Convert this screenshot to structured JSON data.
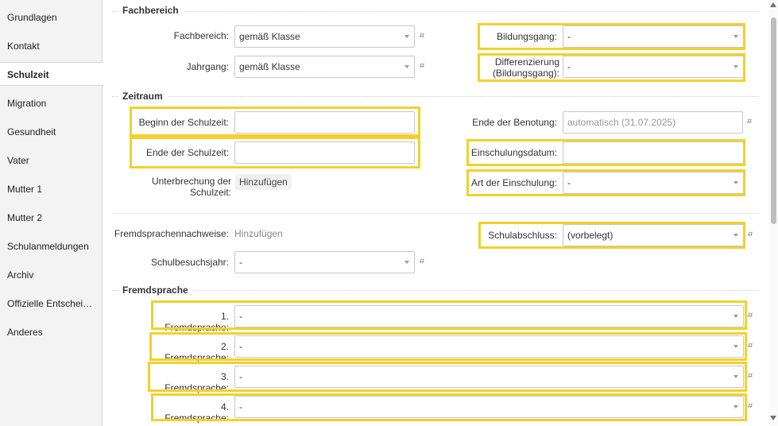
{
  "sidebar": {
    "items": [
      {
        "label": "Grundlagen"
      },
      {
        "label": "Kontakt"
      },
      {
        "label": "Schulzeit"
      },
      {
        "label": "Migration"
      },
      {
        "label": "Gesundheit"
      },
      {
        "label": "Vater"
      },
      {
        "label": "Mutter 1"
      },
      {
        "label": "Mutter 2"
      },
      {
        "label": "Schulanmeldungen"
      },
      {
        "label": "Archiv"
      },
      {
        "label": "Offizielle Entschei…"
      },
      {
        "label": "Anderes"
      }
    ],
    "active": "Schulzeit"
  },
  "fachbereich": {
    "title": "Fachbereich",
    "fachbereich_label": "Fachbereich:",
    "fachbereich_value": "gemäß Klasse",
    "jahrgang_label": "Jahrgang:",
    "jahrgang_value": "gemäß Klasse",
    "bildungsgang_label": "Bildungsgang:",
    "bildungsgang_value": "-",
    "differenzierung_label_1": "Differenzierung",
    "differenzierung_label_2": "(Bildungsgang):",
    "differenzierung_value": "-"
  },
  "zeitraum": {
    "title": "Zeitraum",
    "beginn_label": "Beginn der Schulzeit:",
    "beginn_value": "",
    "ende_label": "Ende der Schulzeit:",
    "ende_value": "",
    "unterbrechung_label_1": "Unterbrechung der",
    "unterbrechung_label_2": "Schulzeit:",
    "unterbrechung_button": "Hinzufügen",
    "ende_benotung_label": "Ende der Benotung:",
    "ende_benotung_value": "automatisch (31.07.2025)",
    "einschulungsdatum_label": "Einschulungsdatum:",
    "einschulungsdatum_value": "",
    "art_einschulung_label": "Art der Einschulung:",
    "art_einschulung_value": "-"
  },
  "misc": {
    "fremdsprachennachweise_label": "Fremdsprachennachweise:",
    "fremdsprachennachweise_button": "Hinzufügen",
    "schulbesuchsjahr_label": "Schulbesuchsjahr:",
    "schulbesuchsjahr_value": "-",
    "schulabschluss_label": "Schulabschluss:",
    "schulabschluss_value": "(vorbelegt)"
  },
  "fremdsprache": {
    "title": "Fremdsprache",
    "items": [
      {
        "label": "1. Fremdsprache:",
        "value": "-"
      },
      {
        "label": "2. Fremdsprache:",
        "value": "-"
      },
      {
        "label": "3. Fremdsprache:",
        "value": "-"
      },
      {
        "label": "4. Fremdsprache:",
        "value": "-"
      }
    ]
  },
  "hash_symbol": "⌗",
  "colors": {
    "highlight": "#f2d12b",
    "sidebar_bg": "#f3f3f3",
    "border": "#c8c8c8"
  }
}
